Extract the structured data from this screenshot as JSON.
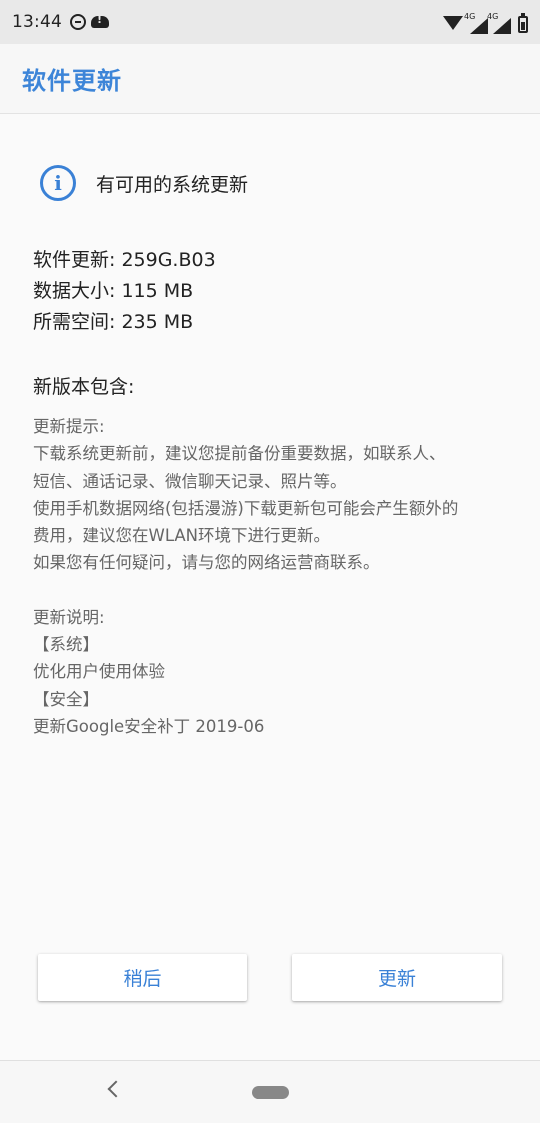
{
  "status_bar": {
    "time": "13:44",
    "left_icons": [
      "do-not-disturb-icon",
      "cloud-alert-icon"
    ],
    "signal_labels": [
      "4G",
      "4G"
    ]
  },
  "app_bar": {
    "title": "软件更新"
  },
  "notice": {
    "icon": "info-icon",
    "text": "有可用的系统更新"
  },
  "meta": {
    "version": "软件更新: 259G.B03",
    "size": "数据大小: 115 MB",
    "space": "所需空间: 235 MB"
  },
  "section_title": "新版本包含:",
  "notes": {
    "tips_header": "更新提示:",
    "tips_lines": [
      "下载系统更新前，建议您提前备份重要数据，如联系人、",
      "短信、通话记录、微信聊天记录、照片等。",
      "使用手机数据网络(包括漫游)下载更新包可能会产生额外的",
      "费用，建议您在WLAN环境下进行更新。",
      "如果您有任何疑问，请与您的网络运营商联系。"
    ],
    "desc_header": "更新说明:",
    "desc_lines": [
      "【系统】",
      "优化用户使用体验",
      "【安全】",
      "更新Google安全补丁 2019-06"
    ]
  },
  "buttons": {
    "later": "稍后",
    "update": "更新"
  },
  "colors": {
    "accent": "#3a81d6",
    "status_bar_bg": "#e9e9e9",
    "page_bg": "#fafafa"
  }
}
